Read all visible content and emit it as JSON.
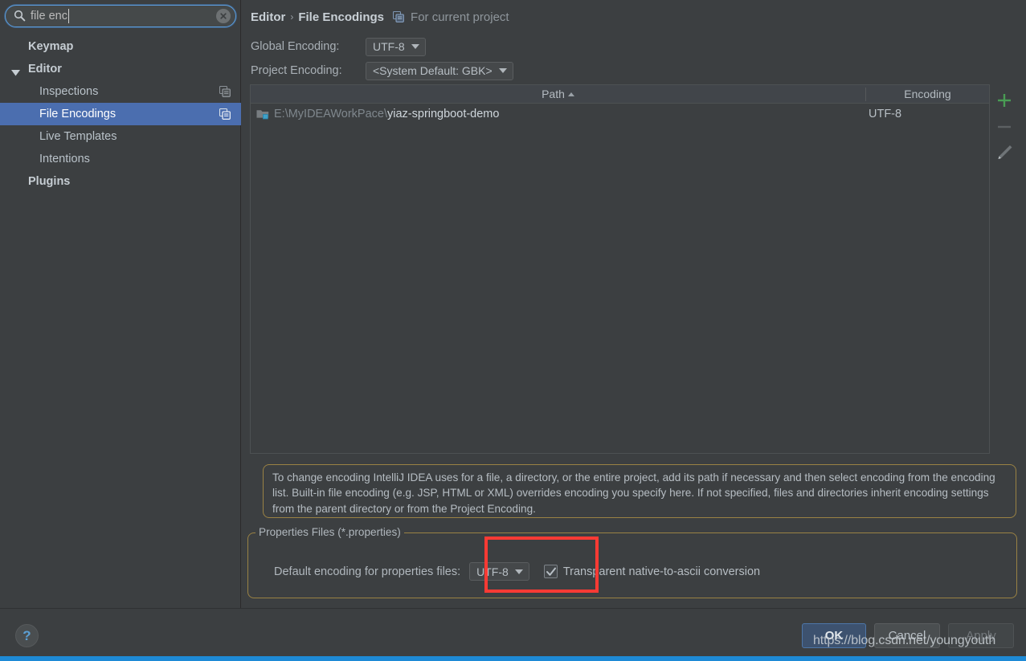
{
  "search": {
    "value": "file enc",
    "icon": "search-icon",
    "clear_icon": "clear-icon"
  },
  "sidebar": {
    "items": [
      {
        "label": "Keymap",
        "level": "top",
        "arrow": false,
        "copy_icon": false,
        "selected": false
      },
      {
        "label": "Editor",
        "level": "top",
        "arrow": true,
        "copy_icon": false,
        "selected": false
      },
      {
        "label": "Inspections",
        "level": "child",
        "arrow": false,
        "copy_icon": true,
        "selected": false
      },
      {
        "label": "File Encodings",
        "level": "child",
        "arrow": false,
        "copy_icon": true,
        "selected": true
      },
      {
        "label": "Live Templates",
        "level": "child",
        "arrow": false,
        "copy_icon": false,
        "selected": false
      },
      {
        "label": "Intentions",
        "level": "child",
        "arrow": false,
        "copy_icon": false,
        "selected": false
      },
      {
        "label": "Plugins",
        "level": "top",
        "arrow": false,
        "copy_icon": false,
        "selected": false
      }
    ]
  },
  "breadcrumb": {
    "parent": "Editor",
    "separator": "›",
    "current": "File Encodings",
    "scope_note": "For current project",
    "scope_icon": "module-copy-icon"
  },
  "fields": {
    "global_encoding_label": "Global Encoding:",
    "global_encoding_value": "UTF-8",
    "project_encoding_label": "Project Encoding:",
    "project_encoding_value": "<System Default: GBK>"
  },
  "table": {
    "columns": [
      {
        "key": "path",
        "label": "Path",
        "sorted": "asc"
      },
      {
        "key": "encoding",
        "label": "Encoding",
        "sorted": "none"
      }
    ],
    "rows": [
      {
        "icon": "module-folder-icon",
        "path_dim": "E:\\MyIDEAWorkPace\\",
        "path_bright": "yiaz-springboot-demo",
        "encoding": "UTF-8"
      }
    ],
    "toolbar": [
      {
        "name": "add-button",
        "glyph": "plus-icon",
        "enabled": true
      },
      {
        "name": "remove-button",
        "glyph": "minus-icon",
        "enabled": false
      },
      {
        "name": "edit-button",
        "glyph": "pencil-icon",
        "enabled": false
      }
    ]
  },
  "info": {
    "text": "To change encoding IntelliJ IDEA uses for a file, a directory, or the entire project, add its path if necessary and then select encoding from the encoding list. Built-in file encoding (e.g. JSP, HTML or XML) overrides encoding you specify here. If not specified, files and directories inherit encoding settings from the parent directory or from the Project Encoding."
  },
  "properties": {
    "legend": "Properties Files (*.properties)",
    "default_encoding_label": "Default encoding for properties files:",
    "default_encoding_value": "UTF-8",
    "transparent_checkbox_label": "Transparent native-to-ascii conversion",
    "transparent_checked": true
  },
  "footer": {
    "help_glyph": "?",
    "ok_label": "OK",
    "cancel_label": "Cancel",
    "apply_label": "Apply"
  },
  "watermark": {
    "text": "https://blog.csdn.net/youngyouth"
  },
  "colors": {
    "background": "#3c3f41",
    "selection": "#4b6eaf",
    "accent_border": "#9a8244",
    "annotation": "#fd3a34",
    "help_blue": "#5b9fd4",
    "status_strip": "#1e8ad6",
    "add_green": "#499c54"
  }
}
